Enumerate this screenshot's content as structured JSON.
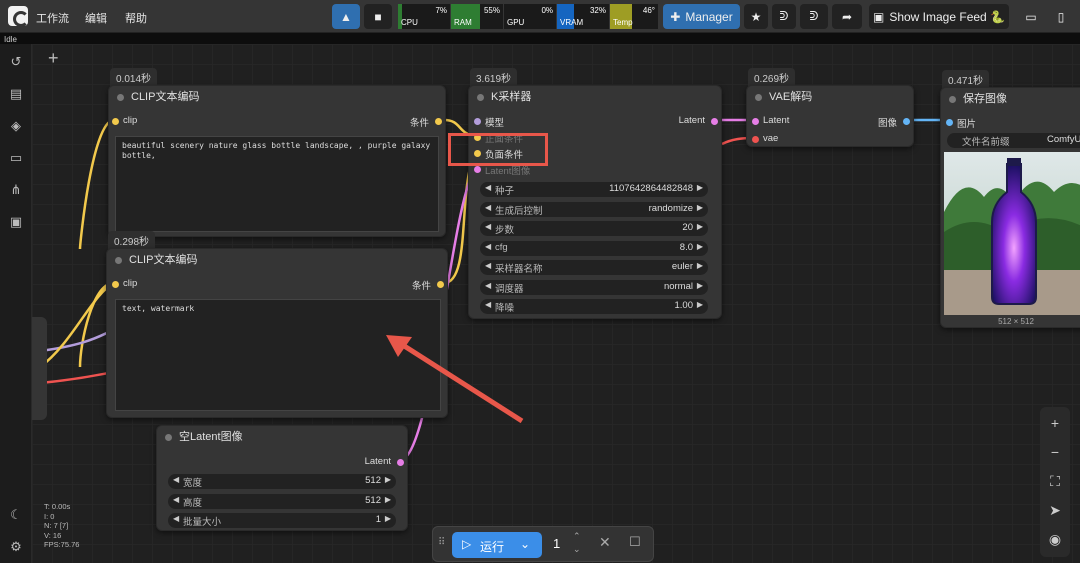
{
  "menu": [
    "工作流",
    "编辑",
    "帮助"
  ],
  "status": "Idle",
  "monitor": [
    {
      "label": "CPU",
      "value": "7%",
      "percent": 7,
      "color": "#2e7d32"
    },
    {
      "label": "RAM",
      "value": "55%",
      "percent": 55,
      "color": "#2e7d32"
    },
    {
      "label": "GPU",
      "value": "0%",
      "percent": 0,
      "color": "#2e7d32"
    },
    {
      "label": "VRAM",
      "value": "32%",
      "percent": 32,
      "color": "#1565c0"
    },
    {
      "label": "Temp",
      "value": "46°",
      "percent": 46,
      "color": "#9e9d24"
    }
  ],
  "toolbar": {
    "manager": "Manager",
    "image_feed": "Show Image Feed 🐍"
  },
  "nodes": {
    "clip1": {
      "time": "0.014秒",
      "title": "CLIP文本编码",
      "in": "clip",
      "out": "条件",
      "text": "beautiful scenery nature glass bottle landscape, , purple galaxy bottle,"
    },
    "clip2": {
      "time": "0.298秒",
      "title": "CLIP文本编码",
      "in": "clip",
      "out": "条件",
      "text": "text, watermark"
    },
    "ksampler": {
      "time": "3.619秒",
      "title": "K采样器",
      "out": "Latent",
      "inputs": [
        "模型",
        "正面条件",
        "负面条件",
        "Latent图像"
      ],
      "widgets": [
        {
          "label": "种子",
          "value": "1107642864482848"
        },
        {
          "label": "生成后控制",
          "value": "randomize"
        },
        {
          "label": "步数",
          "value": "20"
        },
        {
          "label": "cfg",
          "value": "8.0"
        },
        {
          "label": "采样器名称",
          "value": "euler"
        },
        {
          "label": "调度器",
          "value": "normal"
        },
        {
          "label": "降噪",
          "value": "1.00"
        }
      ]
    },
    "vae": {
      "time": "0.269秒",
      "title": "VAE解码",
      "inputs": [
        "Latent",
        "vae"
      ],
      "out": "图像"
    },
    "save": {
      "time": "0.471秒",
      "title": "保存图像",
      "in": "图片",
      "prefix_label": "文件名前缀",
      "prefix_value": "ComfyU",
      "size": "512 × 512"
    },
    "latent": {
      "title": "空Latent图像",
      "out": "Latent",
      "widgets": [
        {
          "label": "宽度",
          "value": "512"
        },
        {
          "label": "高度",
          "value": "512"
        },
        {
          "label": "批量大小",
          "value": "1"
        }
      ]
    }
  },
  "run": {
    "label": "运行",
    "count": "1"
  },
  "stats": [
    "T: 0.00s",
    "I: 0",
    "N: 7 [7]",
    "V: 16",
    "FPS:75.76"
  ],
  "highlight_color": "#e8574a"
}
